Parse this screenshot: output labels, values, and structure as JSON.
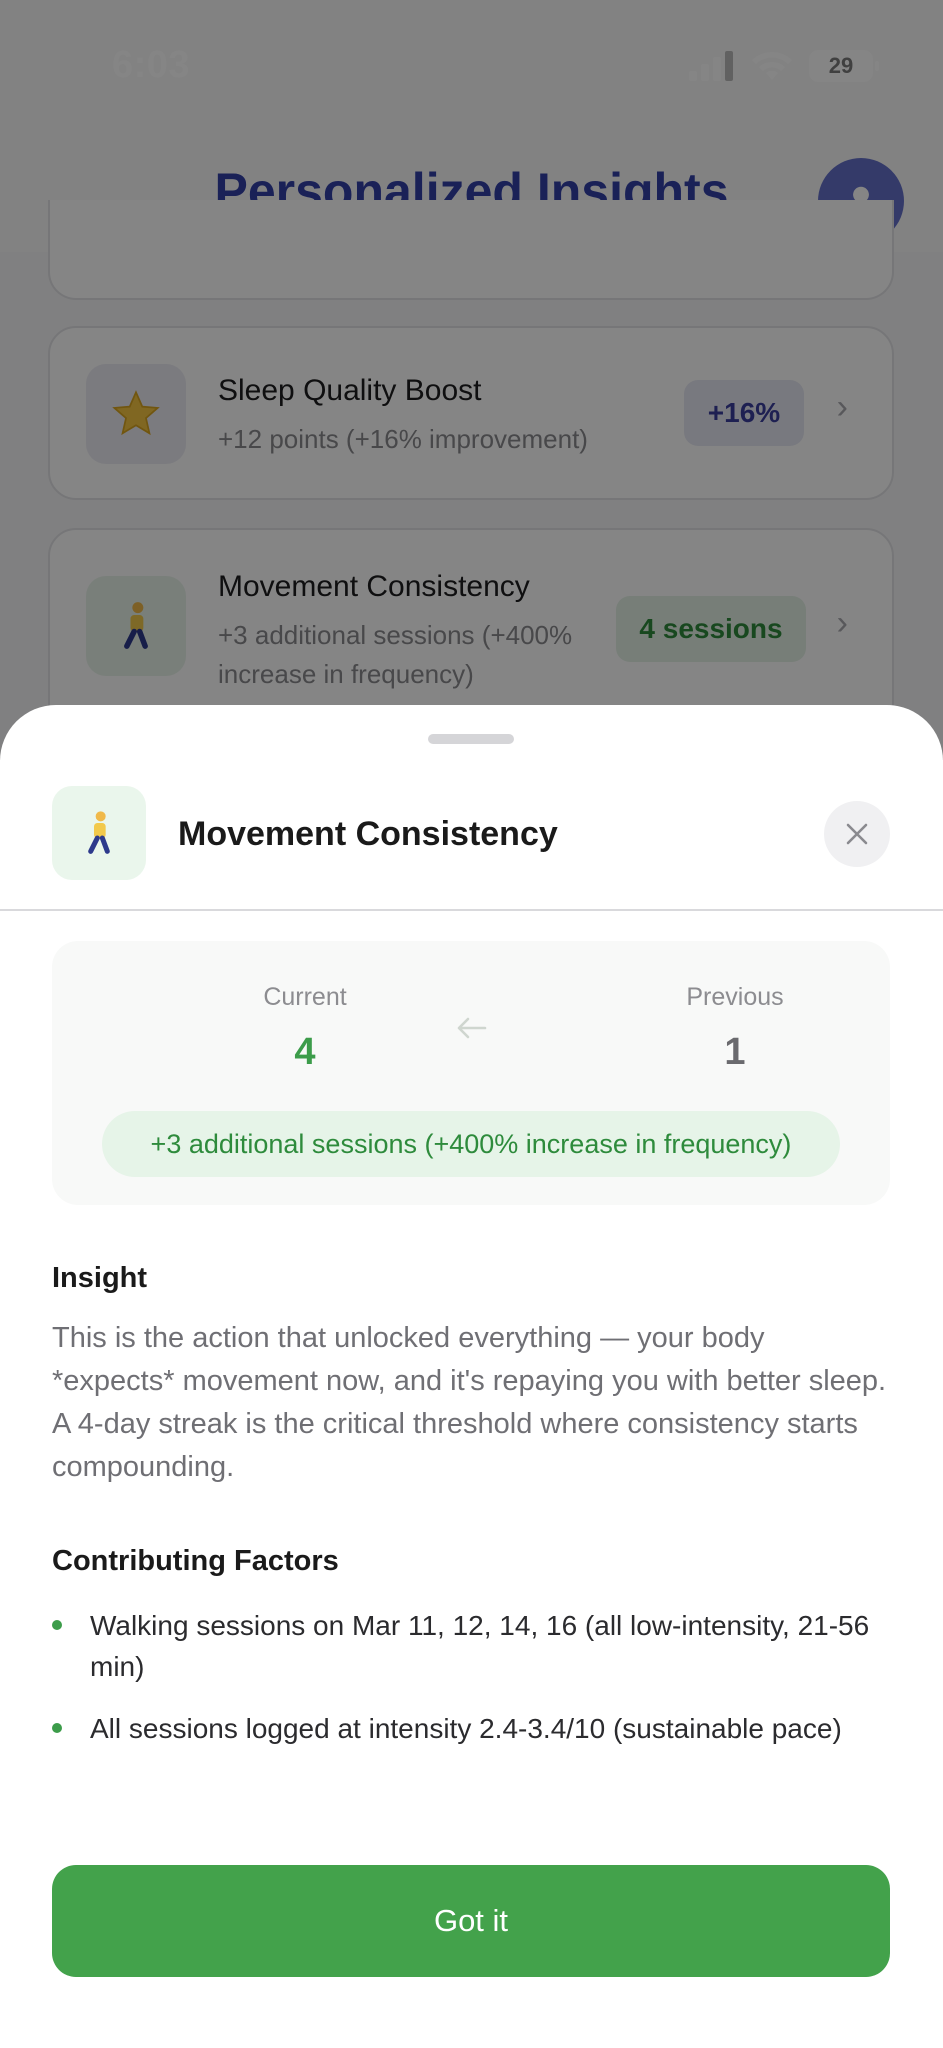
{
  "status": {
    "time": "6:03",
    "battery": "29"
  },
  "header": {
    "title": "Personalized Insights"
  },
  "background_cards": [
    {
      "title": "Sleep Quality Boost",
      "subtitle": "+12 points (+16% improvement)",
      "badge": "+16%"
    },
    {
      "title": "Movement Consistency",
      "subtitle": "+3 additional sessions (+400% increase in frequency)",
      "badge": "4 sessions"
    }
  ],
  "sheet": {
    "title": "Movement Consistency",
    "icon": "walking-person-emoji",
    "current_label": "Current",
    "current_value": "4",
    "previous_label": "Previous",
    "previous_value": "1",
    "delta": "+3 additional sessions (+400% increase in frequency)",
    "insight_title": "Insight",
    "insight_text": "This is the action that unlocked everything — your body *expects* movement now, and it's repaying you with better sleep. A 4-day streak is the critical threshold where consistency starts compounding.",
    "factors_title": "Contributing Factors",
    "factors": [
      "Walking sessions on Mar 11, 12, 14, 16 (all low-intensity, 21-56 min)",
      "All sessions logged at intensity 2.4-3.4/10 (sustainable pace)"
    ],
    "button": "Got it"
  },
  "colors": {
    "accent_green": "#43a24b",
    "title_blue": "#3240a8",
    "badge_purple": "#3b3f9e"
  }
}
